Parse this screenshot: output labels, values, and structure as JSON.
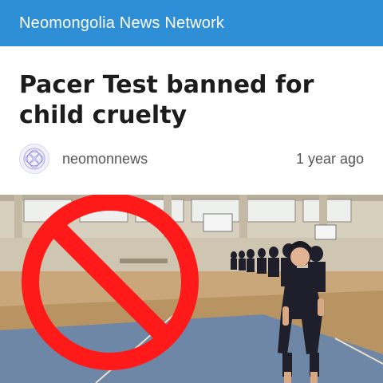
{
  "header": {
    "title": "Neomongolia News Network"
  },
  "article": {
    "headline": "Pacer Test banned for child cruelty",
    "author": "neomonnews",
    "time": "1 year ago",
    "image_icon": "no-entry-symbol"
  },
  "colors": {
    "header_bg": "#2f8fd6",
    "prohibition": "#ff1a1a"
  }
}
